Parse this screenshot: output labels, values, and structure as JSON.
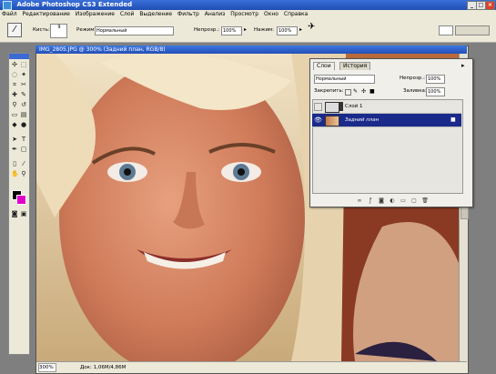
{
  "window": {
    "title": "Adobe Photoshop CS3 Extended"
  },
  "menu": [
    "Файл",
    "Редактирование",
    "Изображение",
    "Слой",
    "Выделение",
    "Фильтр",
    "Анализ",
    "Просмотр",
    "Окно",
    "Справка"
  ],
  "options": {
    "brush_label": "Кисть:",
    "brush_size": "9",
    "mode_label": "Режим:",
    "mode_value": "Нормальный",
    "opacity_label": "Непрозр.:",
    "opacity_value": "100%",
    "flow_label": "Нажим:",
    "flow_value": "100%"
  },
  "document": {
    "title": "IMG_2805.JPG @ 300% (Задний план, RGB/8)",
    "zoom": "300%",
    "doc_size": "Док: 1,06M/4,86M"
  },
  "layers_panel": {
    "tabs": [
      "Слои",
      "История"
    ],
    "blend_mode": "Нормальный",
    "opacity_label": "Непрозр.:",
    "opacity_value": "100%",
    "lock_label": "Закрепить:",
    "fill_label": "Заливка:",
    "fill_value": "100%",
    "layers": [
      {
        "name": "Слой 1",
        "visible": false,
        "selected": false
      },
      {
        "name": "Задний план",
        "visible": true,
        "selected": true
      }
    ]
  },
  "colors": {
    "foreground": "#000000",
    "background": "#e000c8",
    "accent": "#1a2a8a"
  }
}
